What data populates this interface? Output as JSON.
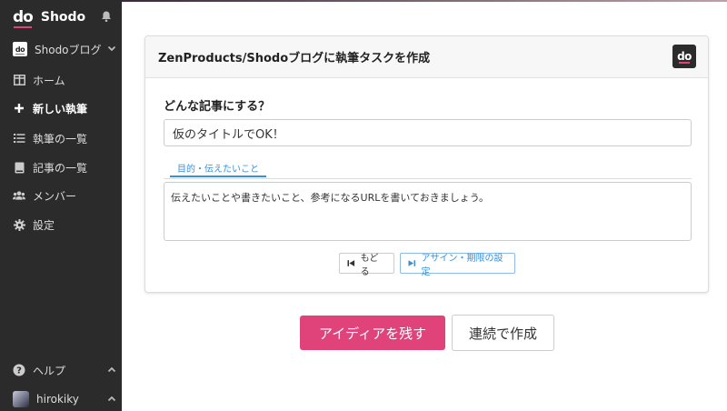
{
  "brand": {
    "logo": "do",
    "name": "Shodo"
  },
  "sidebar": {
    "project": {
      "icon_text": "do",
      "name": "Shodoブログ"
    },
    "items": [
      {
        "label": "ホーム",
        "icon": "layout-icon"
      },
      {
        "label": "新しい執筆",
        "icon": "plus-icon"
      },
      {
        "label": "執筆の一覧",
        "icon": "list-icon"
      },
      {
        "label": "記事の一覧",
        "icon": "book-icon"
      },
      {
        "label": "メンバー",
        "icon": "users-icon"
      },
      {
        "label": "設定",
        "icon": "gear-icon"
      }
    ],
    "help_label": "ヘルプ",
    "user_name": "hirokiky"
  },
  "card": {
    "title": "ZenProducts/Shodoブログに執筆タスクを作成",
    "logo": "do",
    "question": "どんな記事にする？",
    "title_value": "仮のタイトルでOK！",
    "tab_label": "目的・伝えたいこと",
    "textarea_value": "伝えたいことや書きたいこと、参考になるURLを書いておきましょう。",
    "back_label": "もどる",
    "assign_label": "アサイン・期限の設定"
  },
  "actions": {
    "primary_label": "アイディアを残す",
    "secondary_label": "連続で作成"
  },
  "colors": {
    "accent": "#e0437a",
    "link": "#3a8fd6",
    "sidebar": "#2b2b2b"
  }
}
